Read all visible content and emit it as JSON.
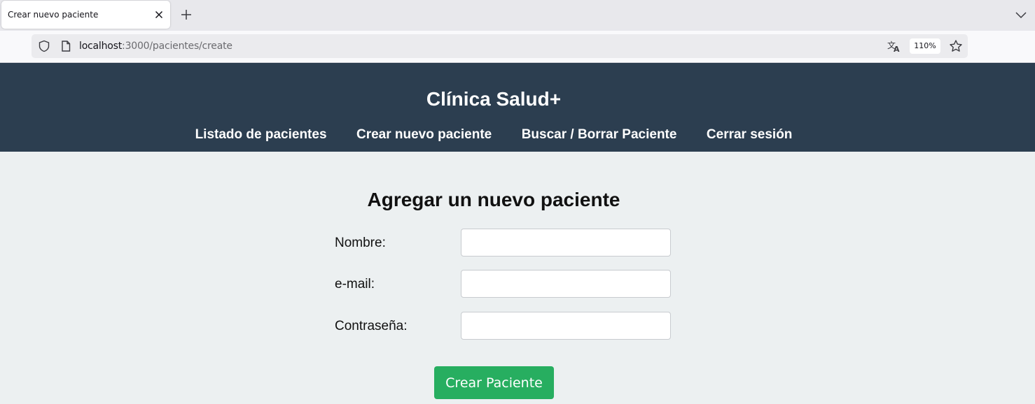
{
  "browser": {
    "tab_title": "Crear nuevo paciente",
    "url_host": "localhost",
    "url_path": ":3000/pacientes/create",
    "zoom": "110%"
  },
  "header": {
    "title": "Clínica Salud+",
    "nav": [
      {
        "label": "Listado de pacientes"
      },
      {
        "label": "Crear nuevo paciente"
      },
      {
        "label": "Buscar / Borrar Paciente"
      },
      {
        "label": "Cerrar sesión"
      }
    ]
  },
  "form": {
    "title": "Agregar un nuevo paciente",
    "fields": [
      {
        "label": "Nombre:",
        "value": ""
      },
      {
        "label": "e-mail:",
        "value": ""
      },
      {
        "label": "Contraseña:",
        "value": ""
      }
    ],
    "submit_label": "Crear Paciente"
  },
  "colors": {
    "header_bg": "#2c3e50",
    "page_bg": "#ecf0f1",
    "button_bg": "#27ae60"
  }
}
